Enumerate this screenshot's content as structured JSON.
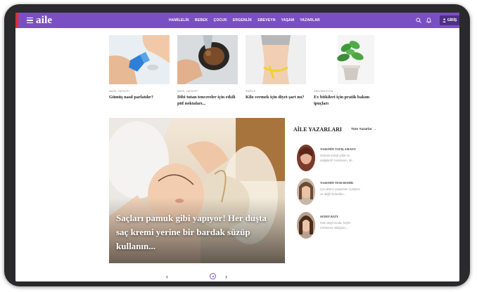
{
  "header": {
    "logo": "aile",
    "nav": [
      "HAMİLELİK",
      "BEBEK",
      "ÇOCUK",
      "ERGENLİK",
      "EBEVEYN",
      "YAŞAM",
      "YAZARLAR"
    ],
    "login_label": "GİRİŞ",
    "accent": "#7b4fc4"
  },
  "cards": [
    {
      "category": "NASIL YAPILIR?",
      "title": "Gümüş nasıl parlatılır?"
    },
    {
      "category": "NASIL YAPILIR?",
      "title": "Dibi tutan tencereler için etkili püf noktaları..."
    },
    {
      "category": "SAĞLIK",
      "title": "Kilo vermek için diyet şart mı?"
    },
    {
      "category": "DEKORASYON",
      "title": "Ev bitkileri için pratik bakım ipuçları"
    }
  ],
  "hero": {
    "title": "Saçları pamuk gibi yapıyor! Her duşta saç kremi yerine bir bardak süzüp kullanın..."
  },
  "sidebar": {
    "heading": "AİLE YAZARLARI",
    "all_link": "Tüm Yazarlar →",
    "authors": [
      {
        "name": "YASEMİN TATIŞ AMATO",
        "line1": "Zamanı kutsal yıllar mı",
        "line2": "değiştirdi? Hatırlarım; ilk..."
      },
      {
        "name": "YASEMİN TEM DEMİR",
        "line1": "Çocukların yaşamları 'Çalışma",
        "line2": "ve değil' ilerlediler..."
      },
      {
        "name": "SEDEF BATI",
        "line1": "Kötü değil moda, keyfin",
        "line2": "Cehennet olduğunu..."
      }
    ]
  },
  "pager": {
    "prev": "‹",
    "next": "›"
  }
}
